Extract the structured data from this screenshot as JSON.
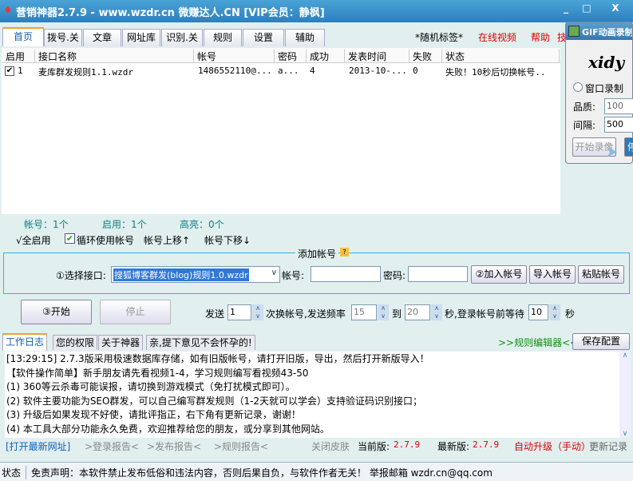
{
  "window": {
    "title": "营销神器2.7.9 - www.wzdr.cn 微赚达人.CN [VIP会员：静枫]",
    "minimize": "_",
    "maximize": "□",
    "close": "X"
  },
  "tabs": [
    "首页",
    "拨号.关",
    "文章",
    "网址库",
    "识别.关",
    "规则",
    "设置",
    "辅助"
  ],
  "top_links": {
    "random_tag": "*随机标签*",
    "online_video": "在线视频",
    "help": "帮助",
    "cut": "技"
  },
  "table": {
    "headers": [
      "启用",
      "接口名称",
      "帐号",
      "密码",
      "成功",
      "发表时间",
      "失败",
      "状态"
    ],
    "rows": [
      {
        "checked": true,
        "index": "1",
        "name": "麦库群发规则1.1.wzdr",
        "account": "1486552110@...",
        "password": "a...",
        "success": "4",
        "time": "2013-10-...",
        "fail": "0",
        "status": "失败！10秒后切换帐号.."
      }
    ]
  },
  "counts": {
    "accounts": "帐号：1个",
    "enabled": "启用：1个",
    "highlight": "高亮：0个"
  },
  "toolbar": {
    "enable_all": "√全启用",
    "loop": "循环使用帐号",
    "loop_checked": true,
    "move_up": "帐号上移↑",
    "move_down": "帐号下移↓"
  },
  "add_account": {
    "legend": "添加帐号",
    "select_label": "①选择接口:",
    "select_value": "搜狐博客群发(blog)规则1.0.wzdr",
    "account_label": "帐号:",
    "password_label": "密码:",
    "add_btn": "②加入帐号",
    "import_btn": "导入帐号",
    "paste_btn": "粘贴帐号"
  },
  "controls": {
    "start": "③开始",
    "stop": "停止",
    "send": "发送",
    "send_val": "1",
    "switch_text": "次换帐号,发送频率",
    "freq_from": "15",
    "to": "到",
    "freq_to": "20",
    "wait_text": "秒,登录帐号前等待",
    "wait_val": "10",
    "sec": "秒"
  },
  "bottom_tabs": [
    "工作日志",
    "您的权限",
    "关于神器",
    "亲,提下意见不会怀孕的!"
  ],
  "rule_editor": ">>规则编辑器<<",
  "save_config": "保存配置",
  "log": [
    "[13:29:15] 2.7.3版采用极速数据库存储，如有旧版帐号，请打开旧版，导出，然后打开新版导入！",
    "【软件操作简单】新手朋友请先看视频1-4，学习规则编写看视频43-50",
    "(1) 360等云杀毒可能误报，请切换到游戏模式（免打扰模式即可）。",
    "(2) 软件主要功能为SEO群发，可以自己编写群发规则（1-2天就可以学会）支持验证码识别接口；",
    "(3) 升级后如果发现不好使，请批评指正，右下角有更新记录，谢谢！",
    "(4) 本工具大部分功能永久免费，欢迎推荐给您的朋友，或分享到其他网站。"
  ],
  "footer": {
    "open_site": "[打开最新网址]",
    "login_report": ">登录报告<",
    "publish_report": ">发布报告<",
    "rule_report": ">规则报告<",
    "close_skin": "关闭皮肤",
    "current_label": "当前版:",
    "current": "2.7.9",
    "latest_label": "最新版:",
    "latest": "2.7.9",
    "auto_upgrade": "自动升级（手动）",
    "changelog": "更新记录"
  },
  "status": {
    "label": "状态",
    "text": "免责声明：本软件禁止发布低俗和违法内容，否则后果自负，与软件作者无关！ 举报邮箱 wzdr.cn@qq.com"
  },
  "gif": {
    "title": "GIF动画录制",
    "logo": "xidy",
    "window_rec": "窗口录制",
    "quality_label": "品质:",
    "quality": "100",
    "interval_label": "间隔:",
    "interval": "500",
    "start_rec": "开始录像",
    "stop": "停"
  }
}
